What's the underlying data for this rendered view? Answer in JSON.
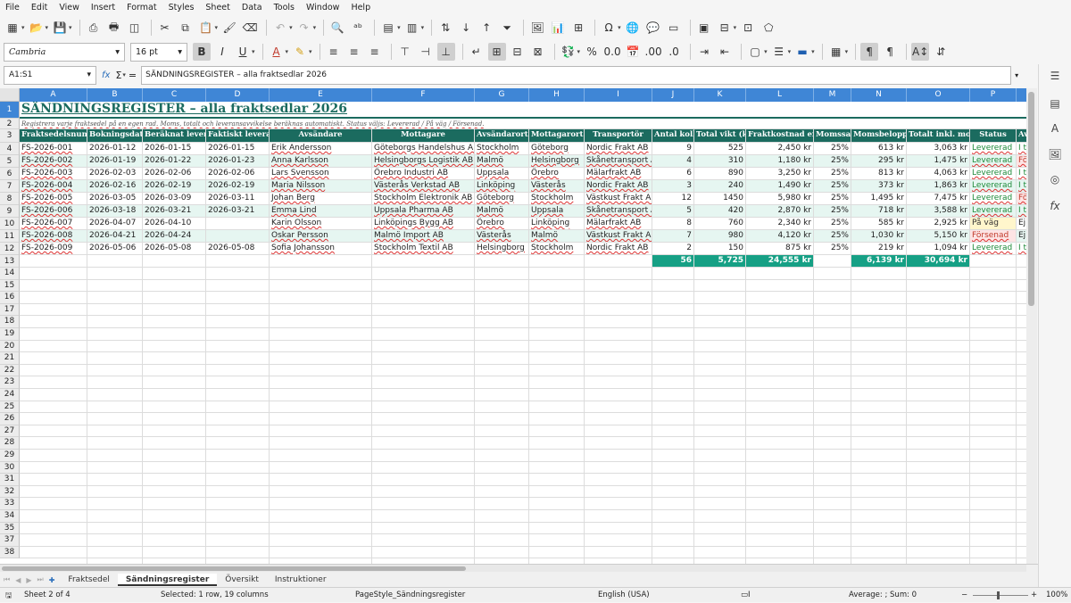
{
  "menu": [
    "File",
    "Edit",
    "View",
    "Insert",
    "Format",
    "Styles",
    "Sheet",
    "Data",
    "Tools",
    "Window",
    "Help"
  ],
  "font": {
    "name": "Cambria",
    "size": "16 pt"
  },
  "namebox": "A1:S1",
  "formula": "SÄNDNINGSREGISTER – alla fraktsedlar 2026",
  "columns": [
    "A",
    "B",
    "C",
    "D",
    "E",
    "F",
    "G",
    "H",
    "I",
    "J",
    "K",
    "L",
    "M",
    "N",
    "O",
    "P"
  ],
  "title": "SÄNDNINGSREGISTER – alla fraktsedlar 2026",
  "subtitle": "Registrera varje fraktsedel på en egen rad. Moms, totalt och leveransavvikelse beräknas automatiskt. Status väljs: Levererad / På väg / Försenad.",
  "headers": [
    "Fraktsedelsnummer",
    "Bokningsdatum",
    "Beräknat leveransdatum",
    "Faktiskt leveransdatum",
    "Avsändare",
    "Mottagare",
    "Avsändarort",
    "Mottagarort",
    "Transportör",
    "Antal kolli",
    "Total vikt (kg)",
    "Fraktkostnad exkl. moms",
    "Momssats",
    "Momsbelopp",
    "Totalt inkl. moms",
    "Status",
    "Av"
  ],
  "rows": [
    [
      "FS-2026-001",
      "2026-01-12",
      "2026-01-15",
      "2026-01-15",
      "Erik Andersson",
      "Göteborgs Handelshus AB",
      "Stockholm",
      "Göteborg",
      "Nordic Frakt AB",
      "9",
      "525",
      "2,450 kr",
      "25%",
      "613 kr",
      "3,063 kr",
      "Levererad",
      "I ti"
    ],
    [
      "FS-2026-002",
      "2026-01-19",
      "2026-01-22",
      "2026-01-23",
      "Anna Karlsson",
      "Helsingborgs Logistik AB",
      "Malmö",
      "Helsingborg",
      "Skånetransport AB",
      "4",
      "310",
      "1,180 kr",
      "25%",
      "295 kr",
      "1,475 kr",
      "Levererad",
      "För"
    ],
    [
      "FS-2026-003",
      "2026-02-03",
      "2026-02-06",
      "2026-02-06",
      "Lars Svensson",
      "Örebro Industri AB",
      "Uppsala",
      "Örebro",
      "Mälarfrakt AB",
      "6",
      "890",
      "3,250 kr",
      "25%",
      "813 kr",
      "4,063 kr",
      "Levererad",
      "I ti"
    ],
    [
      "FS-2026-004",
      "2026-02-16",
      "2026-02-19",
      "2026-02-19",
      "Maria Nilsson",
      "Västerås Verkstad AB",
      "Linköping",
      "Västerås",
      "Nordic Frakt AB",
      "3",
      "240",
      "1,490 kr",
      "25%",
      "373 kr",
      "1,863 kr",
      "Levererad",
      "I ti"
    ],
    [
      "FS-2026-005",
      "2026-03-05",
      "2026-03-09",
      "2026-03-11",
      "Johan Berg",
      "Stockholm Elektronik AB",
      "Göteborg",
      "Stockholm",
      "Västkust Frakt AB",
      "12",
      "1450",
      "5,980 kr",
      "25%",
      "1,495 kr",
      "7,475 kr",
      "Levererad",
      "För"
    ],
    [
      "FS-2026-006",
      "2026-03-18",
      "2026-03-21",
      "2026-03-21",
      "Emma Lind",
      "Uppsala Pharma AB",
      "Malmö",
      "Uppsala",
      "Skånetransport AB",
      "5",
      "420",
      "2,870 kr",
      "25%",
      "718 kr",
      "3,588 kr",
      "Levererad",
      "I ti"
    ],
    [
      "FS-2026-007",
      "2026-04-07",
      "2026-04-10",
      "",
      "Karin Olsson",
      "Linköpings Bygg AB",
      "Örebro",
      "Linköping",
      "Mälarfrakt AB",
      "8",
      "760",
      "2,340 kr",
      "25%",
      "585 kr",
      "2,925 kr",
      "På väg",
      "Ej l"
    ],
    [
      "FS-2026-008",
      "2026-04-21",
      "2026-04-24",
      "",
      "Oskar Persson",
      "Malmö Import AB",
      "Västerås",
      "Malmö",
      "Västkust Frakt AB",
      "7",
      "980",
      "4,120 kr",
      "25%",
      "1,030 kr",
      "5,150 kr",
      "Försenad",
      "Ej l"
    ],
    [
      "FS-2026-009",
      "2026-05-06",
      "2026-05-08",
      "2026-05-08",
      "Sofia Johansson",
      "Stockholm Textil AB",
      "Helsingborg",
      "Stockholm",
      "Nordic Frakt AB",
      "2",
      "150",
      "875 kr",
      "25%",
      "219 kr",
      "1,094 kr",
      "Levererad",
      "I ti"
    ]
  ],
  "totals": {
    "kolli": "56",
    "vikt": "5,725",
    "frakt": "24,555 kr",
    "moms": "6,139 kr",
    "total": "30,694 kr"
  },
  "row_numbers": [
    "1",
    "2",
    "3",
    "4",
    "5",
    "6",
    "7",
    "8",
    "9",
    "10",
    "11",
    "12",
    "13",
    "14",
    "15",
    "16",
    "17",
    "18",
    "19",
    "20",
    "21",
    "22",
    "23",
    "24",
    "25",
    "26",
    "27",
    "28",
    "29",
    "30",
    "31",
    "32",
    "33",
    "34",
    "35",
    "36",
    "37",
    "38"
  ],
  "visible_row_labels": [
    "1",
    "2",
    "3",
    "4",
    "5",
    "6",
    "7",
    "8",
    "9",
    "10",
    "11",
    "12",
    "13",
    "14",
    "15",
    "16",
    "17",
    "18",
    "19",
    "20",
    "21",
    "22",
    "23",
    "24",
    "25",
    "26",
    "27",
    "28",
    "29",
    "30",
    "31",
    "32",
    "33",
    "34",
    "35",
    "37",
    "38"
  ],
  "tabs": [
    "Fraktsedel",
    "Sändningsregister",
    "Översikt",
    "Instruktioner"
  ],
  "active_tab": "Sändningsregister",
  "status": {
    "sheet": "Sheet 2 of 4",
    "selected": "Selected: 1 row, 19 columns",
    "pagestyle": "PageStyle_Sändningsregister",
    "lang": "English (USA)",
    "calc": "Average: ; Sum: 0",
    "zoom": "100%"
  },
  "colors": {
    "header": "#1b6b5f",
    "accent": "#3f86d6",
    "total": "#16a085"
  }
}
